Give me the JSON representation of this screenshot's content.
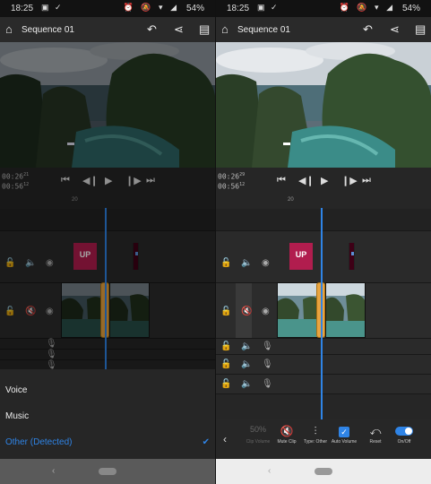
{
  "status": {
    "time": "18:25",
    "battery": "54%"
  },
  "appbar": {
    "title": "Sequence 01"
  },
  "player": {
    "timecode_current": "00:26",
    "timecode_current_frames": "29",
    "timecode_total": "00:56",
    "timecode_total_frames": "12",
    "left_timecode_current_frames": "21"
  },
  "ruler": {
    "label": "20"
  },
  "clips": {
    "title_clip_text": "UP"
  },
  "sheet": {
    "options": [
      "Voice",
      "Music",
      "Other (Detected)"
    ],
    "selected": "Other (Detected)"
  },
  "toolbar": {
    "items": [
      {
        "label": "Clip Volume",
        "value": "50%",
        "icon": "percent-value"
      },
      {
        "label": "Mute Clip",
        "icon": "mute-mic-icon"
      },
      {
        "label": "Type: Other",
        "icon": "waveform-icon"
      },
      {
        "label": "Auto Volume",
        "icon": "checkbox-icon"
      },
      {
        "label": "Reset",
        "icon": "reset-icon"
      },
      {
        "label": "On/Off",
        "icon": "toggle-icon"
      }
    ]
  },
  "colors": {
    "accent": "#2f84e6",
    "title_clip": "#b11d4e",
    "trim": "#e8a440"
  }
}
